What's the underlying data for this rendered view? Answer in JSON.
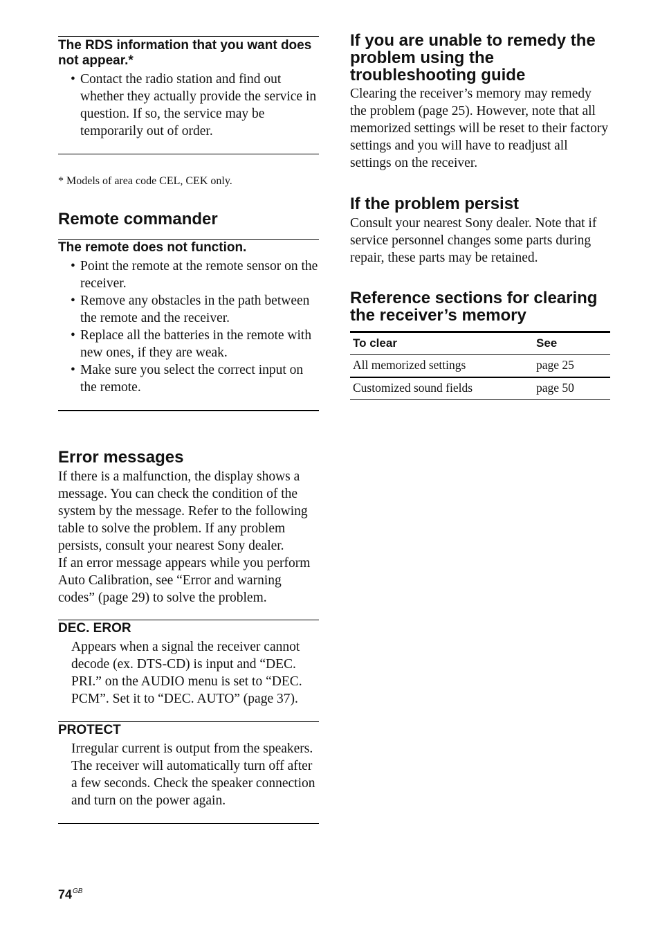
{
  "left_column": {
    "rds": {
      "heading": "The RDS information that you want does not appear.*",
      "bullets": [
        "Contact the radio station and find out whether they actually provide the service in question. If so, the service may be temporarily out of order."
      ],
      "footnote": "* Models of area code CEL, CEK only."
    },
    "remote_commander": {
      "title": "Remote commander",
      "problem_heading": "The remote does not function.",
      "bullets": [
        "Point the remote at the remote sensor on the receiver.",
        "Remove any obstacles in the path between the remote and the receiver.",
        "Replace all the batteries in the remote with new ones, if they are weak.",
        "Make sure you select the correct input on the remote."
      ]
    },
    "error_messages": {
      "title": "Error messages",
      "intro": "If there is a malfunction, the display shows a message. You can check the condition of the system by the message. Refer to the following table to solve the problem. If any problem persists, consult your nearest Sony dealer.",
      "intro2": "If an error message appears while you perform Auto Calibration, see “Error and warning codes” (page 29) to solve the problem.",
      "items": [
        {
          "code": "DEC. EROR",
          "description": "Appears when a signal the receiver cannot decode (ex. DTS-CD) is input and “DEC. PRI.” on the AUDIO menu is set to “DEC. PCM”. Set it to “DEC. AUTO” (page 37)."
        },
        {
          "code": "PROTECT",
          "description": "Irregular current is output from the speakers. The receiver will automatically turn off after a few seconds. Check the speaker connection and turn on the power again."
        }
      ]
    }
  },
  "right_column": {
    "unable": {
      "title": "If you are unable to remedy the problem using the troubleshooting guide",
      "body": "Clearing the receiver’s memory may remedy the problem (page 25). However, note that all memorized settings will be reset to their factory settings and you will have to readjust all settings on the receiver."
    },
    "persist": {
      "title": "If the problem persist",
      "body": "Consult your nearest Sony dealer. Note that if service personnel changes some parts during repair, these parts may be retained."
    },
    "reference": {
      "title": "Reference sections for clearing the receiver’s memory",
      "table": {
        "headers": [
          "To clear",
          "See"
        ],
        "rows": [
          [
            "All memorized settings",
            "page 25"
          ],
          [
            "Customized sound fields",
            "page 50"
          ]
        ]
      }
    }
  },
  "footer": {
    "page_number": "74",
    "page_suffix": "GB"
  }
}
